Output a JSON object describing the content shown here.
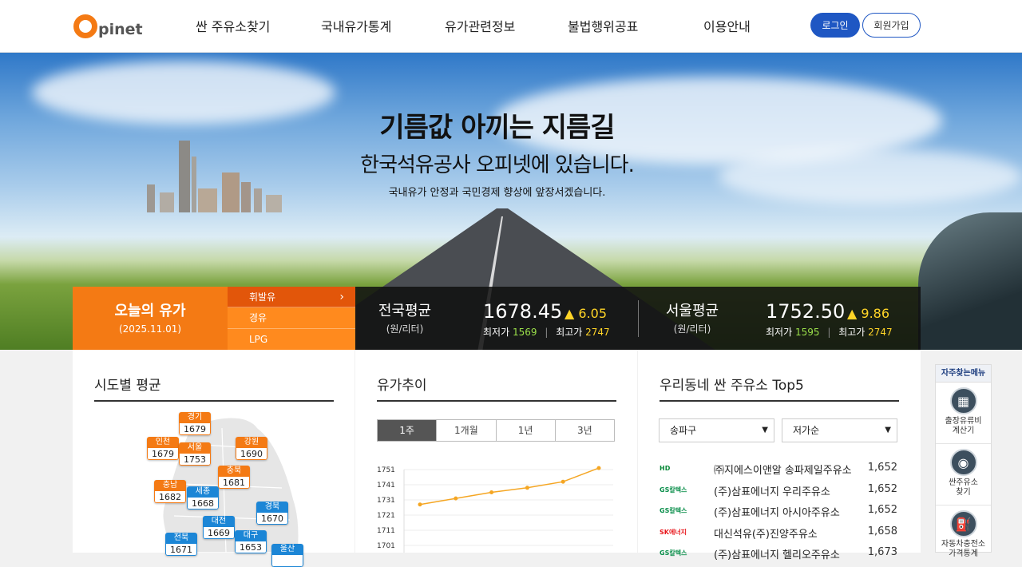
{
  "header": {
    "logo_text": "pinet",
    "nav": [
      "싼 주유소찾기",
      "국내유가통계",
      "유가관련정보",
      "불법행위공표",
      "이용안내"
    ],
    "login_label": "로그인",
    "join_label": "회원가입"
  },
  "hero": {
    "title": "기름값 아끼는 지름길",
    "subtitle": "한국석유공사 오피넷에 있습니다.",
    "description": "국내유가 안정과 국민경제 향상에 앞장서겠습니다."
  },
  "price_bar": {
    "today_title": "오늘의 유가",
    "today_date": "(2025.11.01)",
    "fuel_tabs": [
      "휘발유",
      "경유",
      "LPG"
    ],
    "active_tab": "휘발유",
    "national": {
      "label": "전국평균",
      "unit": "(원/리터)",
      "price": "1678.45",
      "diff": "▲ 6.05",
      "min_label": "최저가",
      "min": "1569",
      "max_label": "최고가",
      "max": "2747"
    },
    "seoul": {
      "label": "서울평균",
      "unit": "(원/리터)",
      "price": "1752.50",
      "diff": "▲ 9.86",
      "min_label": "최저가",
      "min": "1595",
      "max_label": "최고가",
      "max": "2747"
    }
  },
  "regional": {
    "title": "시도별 평균",
    "regions": [
      {
        "name": "경기",
        "value": "1679",
        "style": "or"
      },
      {
        "name": "인천",
        "value": "1679",
        "style": "or"
      },
      {
        "name": "서울",
        "value": "1753",
        "style": "or"
      },
      {
        "name": "강원",
        "value": "1690",
        "style": "or"
      },
      {
        "name": "충북",
        "value": "1681",
        "style": "or"
      },
      {
        "name": "충남",
        "value": "1682",
        "style": "or"
      },
      {
        "name": "세종",
        "value": "1668",
        "style": "bl"
      },
      {
        "name": "경북",
        "value": "1670",
        "style": "bl"
      },
      {
        "name": "대전",
        "value": "1669",
        "style": "bl"
      },
      {
        "name": "전북",
        "value": "1671",
        "style": "bl"
      },
      {
        "name": "대구",
        "value": "1653",
        "style": "bl"
      },
      {
        "name": "울산",
        "value": "",
        "style": "bl"
      }
    ]
  },
  "trend": {
    "title": "유가추이",
    "periods": [
      "1주",
      "1개월",
      "1년",
      "3년"
    ],
    "active_period": "1주"
  },
  "chart_data": {
    "type": "line",
    "y_ticks": [
      "1751",
      "1741",
      "1731",
      "1721",
      "1711",
      "1701"
    ],
    "ylim": [
      1701,
      1751
    ],
    "values": [
      1728,
      1732,
      1736,
      1739,
      1743,
      1752
    ],
    "color": "#f5a623"
  },
  "top5": {
    "title": "우리동네 싼 주유소 Top5",
    "district": "송파구",
    "sort": "저가순",
    "stations": [
      {
        "brand": "HD",
        "brand_color": "#0b8a3a",
        "name": "㈜지에스이앤알 송파제일주유소",
        "price": "1,652"
      },
      {
        "brand": "GS칼텍스",
        "brand_color": "#0c8f4c",
        "name": "(주)삼표에너지 우리주유소",
        "price": "1,652"
      },
      {
        "brand": "GS칼텍스",
        "brand_color": "#0c8f4c",
        "name": "(주)삼표에너지 아시아주유소",
        "price": "1,652"
      },
      {
        "brand": "SK에너지",
        "brand_color": "#e8161b",
        "name": "대신석유(주)진양주유소",
        "price": "1,658"
      },
      {
        "brand": "GS칼텍스",
        "brand_color": "#0c8f4c",
        "name": "(주)삼표에너지 헬리오주유소",
        "price": "1,673"
      }
    ]
  },
  "side_menu": {
    "title": "자주찾는메뉴",
    "items": [
      "출장유류비\n계산기",
      "싼주유소\n찾기",
      "자동차충전소\n가격통계"
    ]
  }
}
